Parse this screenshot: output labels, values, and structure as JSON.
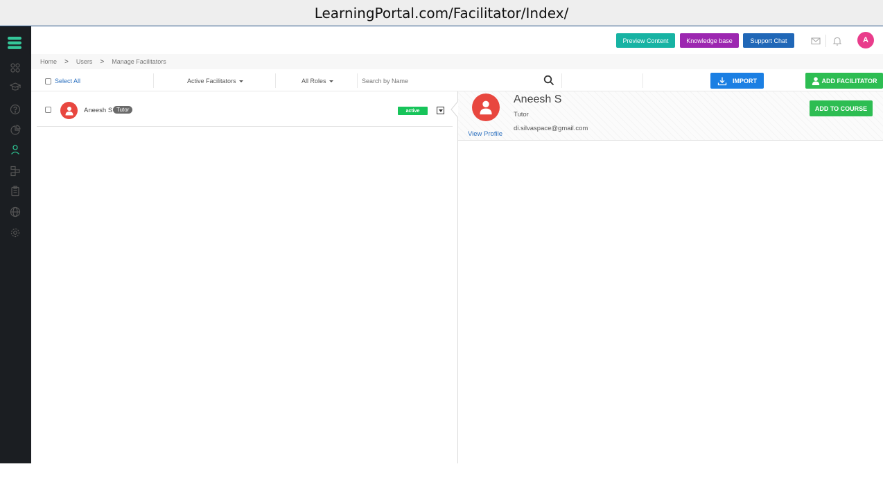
{
  "browser": {
    "url": "LearningPortal.com/Facilitator/Index/"
  },
  "topbar": {
    "preview_label": "Preview Content",
    "knowledge_label": "Knowledge base",
    "support_label": "Support Chat",
    "user_initial": "A",
    "colors": {
      "preview": "#17b3a3",
      "knowledge": "#9c27b0",
      "support": "#2067b7"
    }
  },
  "breadcrumb": {
    "home": "Home",
    "users": "Users",
    "current": "Manage Facilitators"
  },
  "filters": {
    "select_all": "Select All",
    "status_filter": "Active Facilitators",
    "role_filter": "All Roles",
    "search_placeholder": "Search by Name",
    "import_label": "IMPORT",
    "add_label": "ADD FACILITATOR"
  },
  "list": {
    "items": [
      {
        "name": "Aneesh S",
        "role_badge": "Tutor",
        "status": "active"
      }
    ]
  },
  "detail": {
    "name": "Aneesh S",
    "role": "Tutor",
    "email": "di.silvaspace@gmail.com",
    "view_profile": "View Profile",
    "add_to_course": "ADD TO COURSE"
  },
  "sidebar": {
    "icons": [
      "dashboard-icon",
      "courses-icon",
      "help-icon",
      "reports-icon",
      "users-icon",
      "flow-icon",
      "assessment-icon",
      "globe-icon",
      "settings-icon"
    ],
    "active": "users-icon",
    "active_color": "#2dbd8e"
  }
}
